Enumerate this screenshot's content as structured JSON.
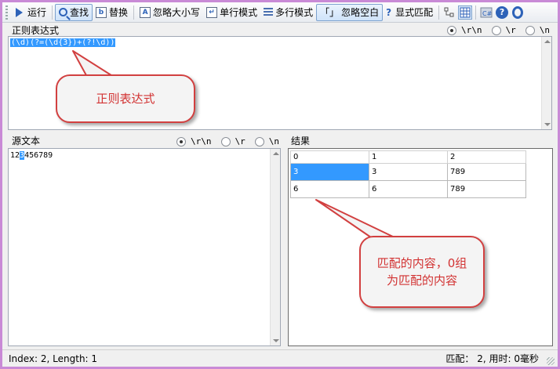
{
  "toolbar": {
    "run": "运行",
    "find": "查找",
    "replace": "替换",
    "ignore_case": "忽略大小写",
    "single_line": "单行模式",
    "multi_line": "多行模式",
    "ignore_whitespace": "忽略空白",
    "explicit_capture": "显式匹配",
    "question_glyph": "?",
    "bracket_glyph": "「」",
    "help_glyph": "?"
  },
  "regex_panel": {
    "title": "正则表达式",
    "pattern": "(\\d)(?=(\\d{3})+(?!\\d))",
    "newline_options": [
      "\\r\\n",
      "\\r",
      "\\n"
    ],
    "selected_newline": "\\r\\n"
  },
  "source_panel": {
    "title": "源文本",
    "text_before": "12",
    "text_selected": "3",
    "text_after": "456789",
    "newline_options": [
      "\\r\\n",
      "\\r",
      "\\n"
    ],
    "selected_newline": "\\r\\n"
  },
  "results_panel": {
    "title": "结果",
    "columns": [
      "0",
      "1",
      "2"
    ],
    "rows": [
      [
        "3",
        "3",
        "789"
      ],
      [
        "6",
        "6",
        "789"
      ]
    ]
  },
  "callouts": {
    "regex": "正则表达式",
    "result_line1": "匹配的内容，0组",
    "result_line2": "为匹配的内容"
  },
  "status": {
    "left": "Index: 2, Length: 1",
    "right": "匹配： 2, 用时: 0毫秒"
  },
  "colors": {
    "selection": "#3399ff",
    "callout_border": "#d24040",
    "callout_text": "#d23333",
    "window_border": "#c98ad6"
  }
}
